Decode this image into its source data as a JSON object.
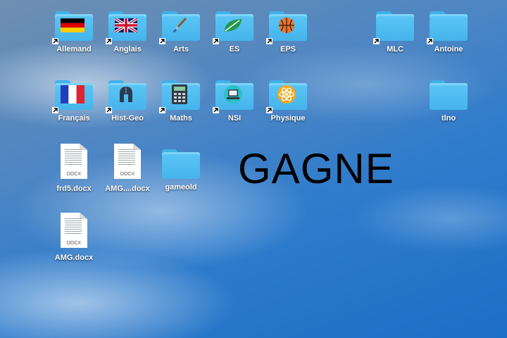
{
  "desktop": {
    "folders": {
      "allemand": "Allemand",
      "anglais": "Anglais",
      "arts": "Arts",
      "es": "ES",
      "eps": "EPS",
      "mlc": "MLC",
      "antoine": "Antoine",
      "francais": "Français",
      "histgeo": "Hist-Geo",
      "maths": "Maths",
      "nsi": "NSI",
      "physique": "Physique",
      "tlno": "tlno",
      "gameold": "gameold"
    },
    "documents": {
      "frd5": "frd5.docx",
      "amg_short": "AMG....docx",
      "amg": "AMG.docx",
      "ext": "DOCX"
    },
    "banner_text": "GAGNE"
  },
  "colors": {
    "folder": "#45b4ec",
    "folder_tab": "#3fb1e8",
    "label": "#ffffff",
    "banner": "#000000"
  },
  "icons": {
    "allemand": "germany-flag-icon",
    "anglais": "uk-flag-icon",
    "arts": "paintbrush-icon",
    "es": "leaf-icon",
    "eps": "basketball-icon",
    "francais": "france-flag-icon",
    "histgeo": "helmet-icon",
    "maths": "calculator-icon",
    "nsi": "computer-icon",
    "physique": "atom-icon",
    "alias": "alias-arrow-icon",
    "docx": "document-icon"
  }
}
